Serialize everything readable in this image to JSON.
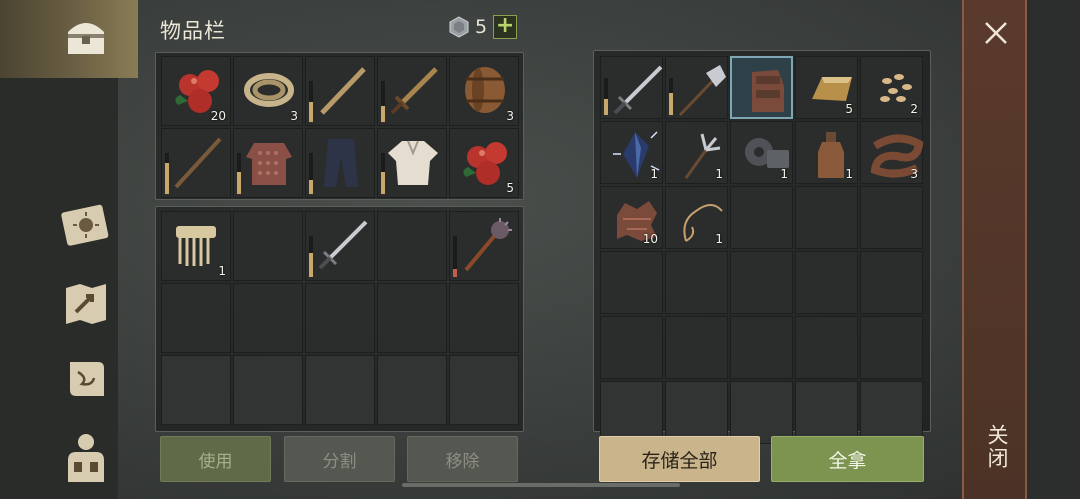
{
  "inventory": {
    "title": "物品栏",
    "currency": "5",
    "add_label": "+"
  },
  "buttons": {
    "use": "使用",
    "split": "分割",
    "remove": "移除",
    "store_all": "存储全部",
    "take_all": "全拿"
  },
  "close": {
    "label": "关闭",
    "icon": "×"
  },
  "left_items": [
    {
      "icon": "apples-icon",
      "qty": "20",
      "durability": null
    },
    {
      "icon": "rope-icon",
      "qty": "3",
      "durability": null
    },
    {
      "icon": "wooden-stick-icon",
      "qty": "",
      "durability": 0.5
    },
    {
      "icon": "bronze-sword-icon",
      "qty": "",
      "durability": 0.4
    },
    {
      "icon": "barrel-icon",
      "qty": "3",
      "durability": null
    },
    {
      "icon": "spear-icon",
      "qty": "",
      "durability": 0.75
    },
    {
      "icon": "chainmail-icon",
      "qty": "",
      "durability": 0.55
    },
    {
      "icon": "trousers-icon",
      "qty": "",
      "durability": 0.35
    },
    {
      "icon": "shirt-icon",
      "qty": "",
      "durability": 0.55
    },
    {
      "icon": "apples-icon",
      "qty": "5",
      "durability": null
    },
    {
      "icon": "comb-icon",
      "qty": "1",
      "durability": null
    },
    {
      "icon": "",
      "qty": "",
      "durability": null
    },
    {
      "icon": "steel-sword-icon",
      "qty": "",
      "durability": 0.6
    },
    {
      "icon": "",
      "qty": "",
      "durability": null
    },
    {
      "icon": "mace-icon",
      "qty": "",
      "durability": 0.2
    }
  ],
  "right_items": [
    {
      "icon": "steel-sword-icon",
      "qty": "",
      "durability": 0.45
    },
    {
      "icon": "halberd-icon",
      "qty": "",
      "durability": 0.6
    },
    {
      "icon": "gauntlet-icon",
      "qty": "",
      "durability": null,
      "selected": true
    },
    {
      "icon": "gold-ingot-icon",
      "qty": "5",
      "durability": null
    },
    {
      "icon": "seeds-icon",
      "qty": "2",
      "durability": null
    },
    {
      "icon": "crystal-icon",
      "qty": "1",
      "durability": null
    },
    {
      "icon": "fork-icon",
      "qty": "1",
      "durability": null
    },
    {
      "icon": "gear-parts-icon",
      "qty": "1",
      "durability": null
    },
    {
      "icon": "bottle-icon",
      "qty": "1",
      "durability": null
    },
    {
      "icon": "leather-strip-icon",
      "qty": "3",
      "durability": null
    },
    {
      "icon": "scrap-icon",
      "qty": "10",
      "durability": null
    },
    {
      "icon": "cord-icon",
      "qty": "1",
      "durability": null
    }
  ],
  "colors": {
    "take_all": "#7c9450",
    "store_all": "#c9b48c",
    "close_panel": "#5a3a2c",
    "selected_cell": "#7ea6b4"
  }
}
